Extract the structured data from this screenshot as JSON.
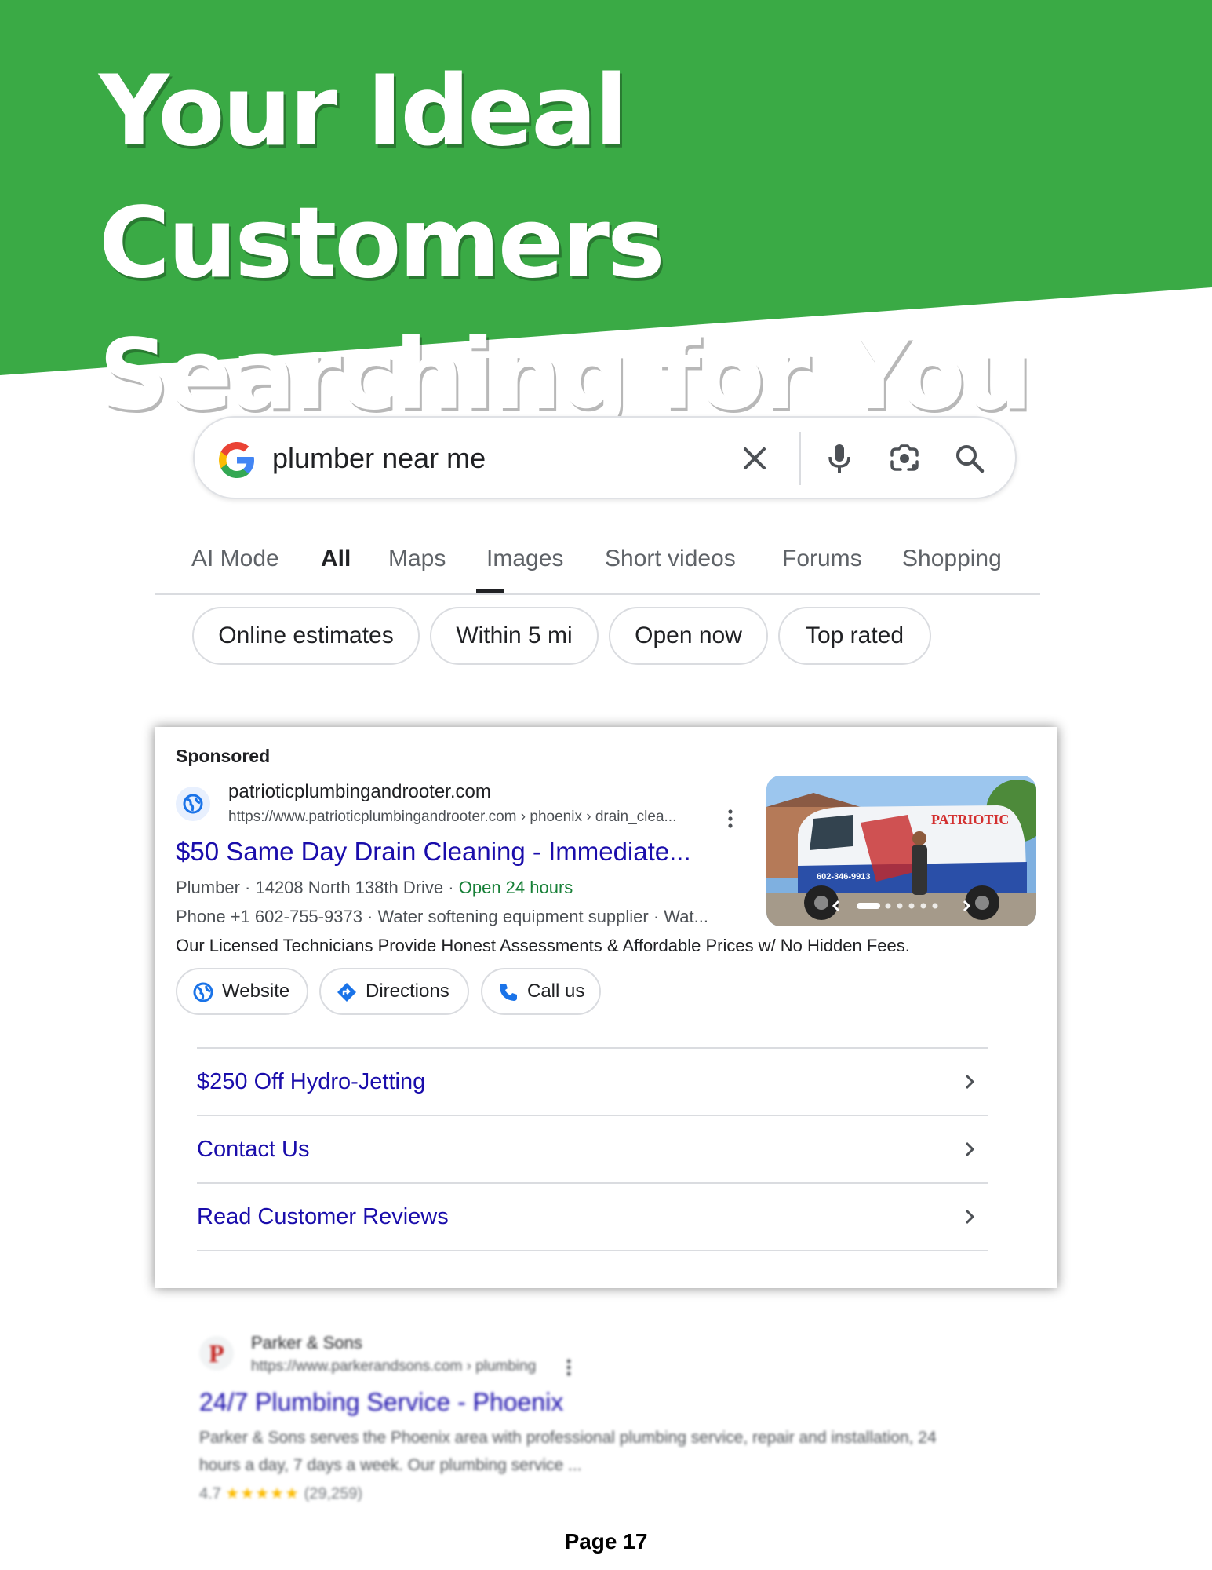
{
  "headline": {
    "line1": "Your Ideal Customers",
    "line2": "Searching for You"
  },
  "search": {
    "query": "plumber near me"
  },
  "tabs": [
    "AI Mode",
    "All",
    "Maps",
    "Images",
    "Short videos",
    "Forums",
    "Shopping"
  ],
  "active_tab": "All",
  "chips": [
    "Online estimates",
    "Within 5 mi",
    "Open now",
    "Top rated"
  ],
  "ad": {
    "sponsored_label": "Sponsored",
    "site_name": "patrioticplumbingandrooter.com",
    "site_url": "https://www.patrioticplumbingandrooter.com › phoenix › drain_clea...",
    "title": "$50 Same Day Drain Cleaning - Immediate...",
    "meta_line1_prefix": "Plumber · 14208 North 138th Drive · ",
    "open_status": "Open 24 hours",
    "meta_line2": "Phone +1 602-755-9373 · Water softening equipment supplier · Wat...",
    "description": "Our Licensed Technicians Provide Honest Assessments & Affordable Prices w/ No Hidden Fees.",
    "buttons": {
      "website": "Website",
      "directions": "Directions",
      "call": "Call us"
    },
    "image_text": {
      "brand": "PATRIOTIC",
      "phone": "602-346-9913"
    },
    "sitelinks": [
      "$250 Off Hydro-Jetting",
      "Contact Us",
      "Read Customer Reviews"
    ]
  },
  "organic": {
    "logo_letter": "P",
    "site_name": "Parker & Sons",
    "site_url": "https://www.parkerandsons.com › plumbing",
    "title": "24/7 Plumbing Service - Phoenix",
    "desc_line1": "Parker & Sons serves the Phoenix area with professional plumbing service, repair and installation, 24",
    "desc_line2": "hours a day, 7 days a week. Our plumbing service ...",
    "rating": "4.7",
    "stars": "★★★★★",
    "reviews": "(29,259)"
  },
  "colors": {
    "banner": "#3aaa45",
    "link": "#1a0dab",
    "open": "#188038"
  },
  "page_label": "Page 17"
}
